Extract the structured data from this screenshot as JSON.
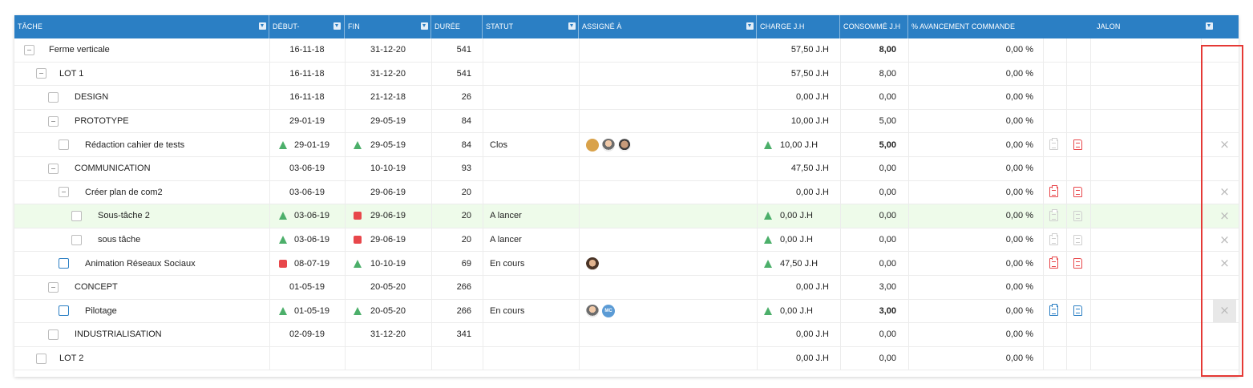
{
  "columns": {
    "tache": "TÂCHE",
    "debut": "DÉBUT-",
    "fin": "FIN",
    "duree": "DURÉE",
    "statut": "STATUT",
    "assigne": "ASSIGNÉ À",
    "charge": "CHARGE J.H",
    "consomme": "CONSOMMÉ J.H",
    "avancement": "% AVANCEMENT COMMANDE",
    "jalon": "JALON"
  },
  "colors": {
    "header_bg": "#2b7fc4",
    "success_green": "#4caf6a",
    "alert_red": "#e8474b",
    "highlight_row": "#eefbea",
    "annotation_red": "#e53935"
  },
  "rows": [
    {
      "name": "Ferme verticale",
      "level": 0,
      "checkbox": "minus",
      "debut": "16-11-18",
      "fin": "31-12-20",
      "duree": "541",
      "statut": "",
      "charge": "57,50 J.H",
      "consomme": "8,00",
      "consomme_bold": true,
      "avancement": "0,00 %"
    },
    {
      "name": "LOT 1",
      "level": 1,
      "checkbox": "minus",
      "debut": "16-11-18",
      "fin": "31-12-20",
      "duree": "541",
      "statut": "",
      "charge": "57,50 J.H",
      "consomme": "8,00",
      "avancement": "0,00 %"
    },
    {
      "name": "DESIGN",
      "level": 2,
      "checkbox": "empty",
      "debut": "16-11-18",
      "fin": "21-12-18",
      "duree": "26",
      "statut": "",
      "charge": "0,00 J.H",
      "consomme": "0,00",
      "avancement": "0,00 %"
    },
    {
      "name": "PROTOTYPE",
      "level": 2,
      "checkbox": "minus",
      "debut": "29-01-19",
      "fin": "29-05-19",
      "duree": "84",
      "statut": "",
      "charge": "10,00 J.H",
      "consomme": "5,00",
      "avancement": "0,00 %"
    },
    {
      "name": "Rédaction cahier de tests",
      "level": 3,
      "checkbox": "empty",
      "debut": "29-01-19",
      "debut_icon": "tri-green",
      "fin": "29-05-19",
      "fin_icon": "tri-green",
      "duree": "84",
      "statut": "Clos",
      "assignees": [
        "av1",
        "av2",
        "av3"
      ],
      "charge": "10,00 J.H",
      "charge_icon": "tri-green",
      "consomme": "5,00",
      "consomme_bold": true,
      "avancement": "0,00 %",
      "docs": [
        "grey",
        "red"
      ],
      "close": "x"
    },
    {
      "name": "COMMUNICATION",
      "level": 2,
      "checkbox": "minus",
      "debut": "03-06-19",
      "fin": "10-10-19",
      "duree": "93",
      "statut": "",
      "charge": "47,50 J.H",
      "consomme": "0,00",
      "avancement": "0,00 %"
    },
    {
      "name": "Créer plan de com2",
      "level": 3,
      "checkbox": "minus",
      "debut": "03-06-19",
      "fin": "29-06-19",
      "duree": "20",
      "statut": "",
      "charge": "0,00 J.H",
      "consomme": "0,00",
      "avancement": "0,00 %",
      "docs": [
        "red",
        "red"
      ],
      "close": "x"
    },
    {
      "name": "Sous-tâche 2",
      "level": 4,
      "checkbox": "empty",
      "highlight": true,
      "debut": "03-06-19",
      "debut_icon": "tri-green",
      "fin": "29-06-19",
      "fin_icon": "sq-red",
      "duree": "20",
      "statut": "A lancer",
      "charge": "0,00 J.H",
      "charge_icon": "tri-green",
      "consomme": "0,00",
      "avancement": "0,00 %",
      "docs": [
        "grey",
        "grey"
      ],
      "close": "x"
    },
    {
      "name": "sous tâche",
      "level": 4,
      "checkbox": "empty",
      "debut": "03-06-19",
      "debut_icon": "tri-green",
      "fin": "29-06-19",
      "fin_icon": "sq-red",
      "duree": "20",
      "statut": "A lancer",
      "charge": "0,00 J.H",
      "charge_icon": "tri-green",
      "consomme": "0,00",
      "avancement": "0,00 %",
      "docs": [
        "grey",
        "grey"
      ],
      "close": "x"
    },
    {
      "name": "Animation Réseaux Sociaux",
      "level": 3,
      "checkbox": "blue",
      "debut": "08-07-19",
      "debut_icon": "sq-red",
      "fin": "10-10-19",
      "fin_icon": "tri-green",
      "duree": "69",
      "statut": "En cours",
      "assignees": [
        "av4"
      ],
      "charge": "47,50 J.H",
      "charge_icon": "tri-green",
      "consomme": "0,00",
      "avancement": "0,00 %",
      "docs": [
        "red",
        "red"
      ],
      "close": "x"
    },
    {
      "name": "CONCEPT",
      "level": 2,
      "checkbox": "minus",
      "debut": "01-05-19",
      "fin": "20-05-20",
      "duree": "266",
      "statut": "",
      "charge": "0,00 J.H",
      "consomme": "3,00",
      "avancement": "0,00 %"
    },
    {
      "name": "Pilotage",
      "level": 3,
      "checkbox": "blue",
      "debut": "01-05-19",
      "debut_icon": "tri-green",
      "fin": "20-05-20",
      "fin_icon": "tri-green",
      "duree": "266",
      "statut": "En cours",
      "assignees": [
        "av2",
        "av5"
      ],
      "charge": "0,00 J.H",
      "charge_icon": "tri-green",
      "consomme": "3,00",
      "consomme_bold": true,
      "avancement": "0,00 %",
      "docs": [
        "blue",
        "blue"
      ],
      "close": "box"
    },
    {
      "name": "INDUSTRIALISATION",
      "level": 2,
      "checkbox": "empty",
      "debut": "02-09-19",
      "fin": "31-12-20",
      "duree": "341",
      "statut": "",
      "charge": "0,00 J.H",
      "consomme": "0,00",
      "avancement": "0,00 %"
    },
    {
      "name": "LOT 2",
      "level": 1,
      "checkbox": "empty",
      "debut": "",
      "fin": "",
      "duree": "",
      "statut": "",
      "charge": "0,00 J.H",
      "consomme": "0,00",
      "avancement": "0,00 %"
    }
  ],
  "avatar_labels": {
    "av5": "MC"
  }
}
